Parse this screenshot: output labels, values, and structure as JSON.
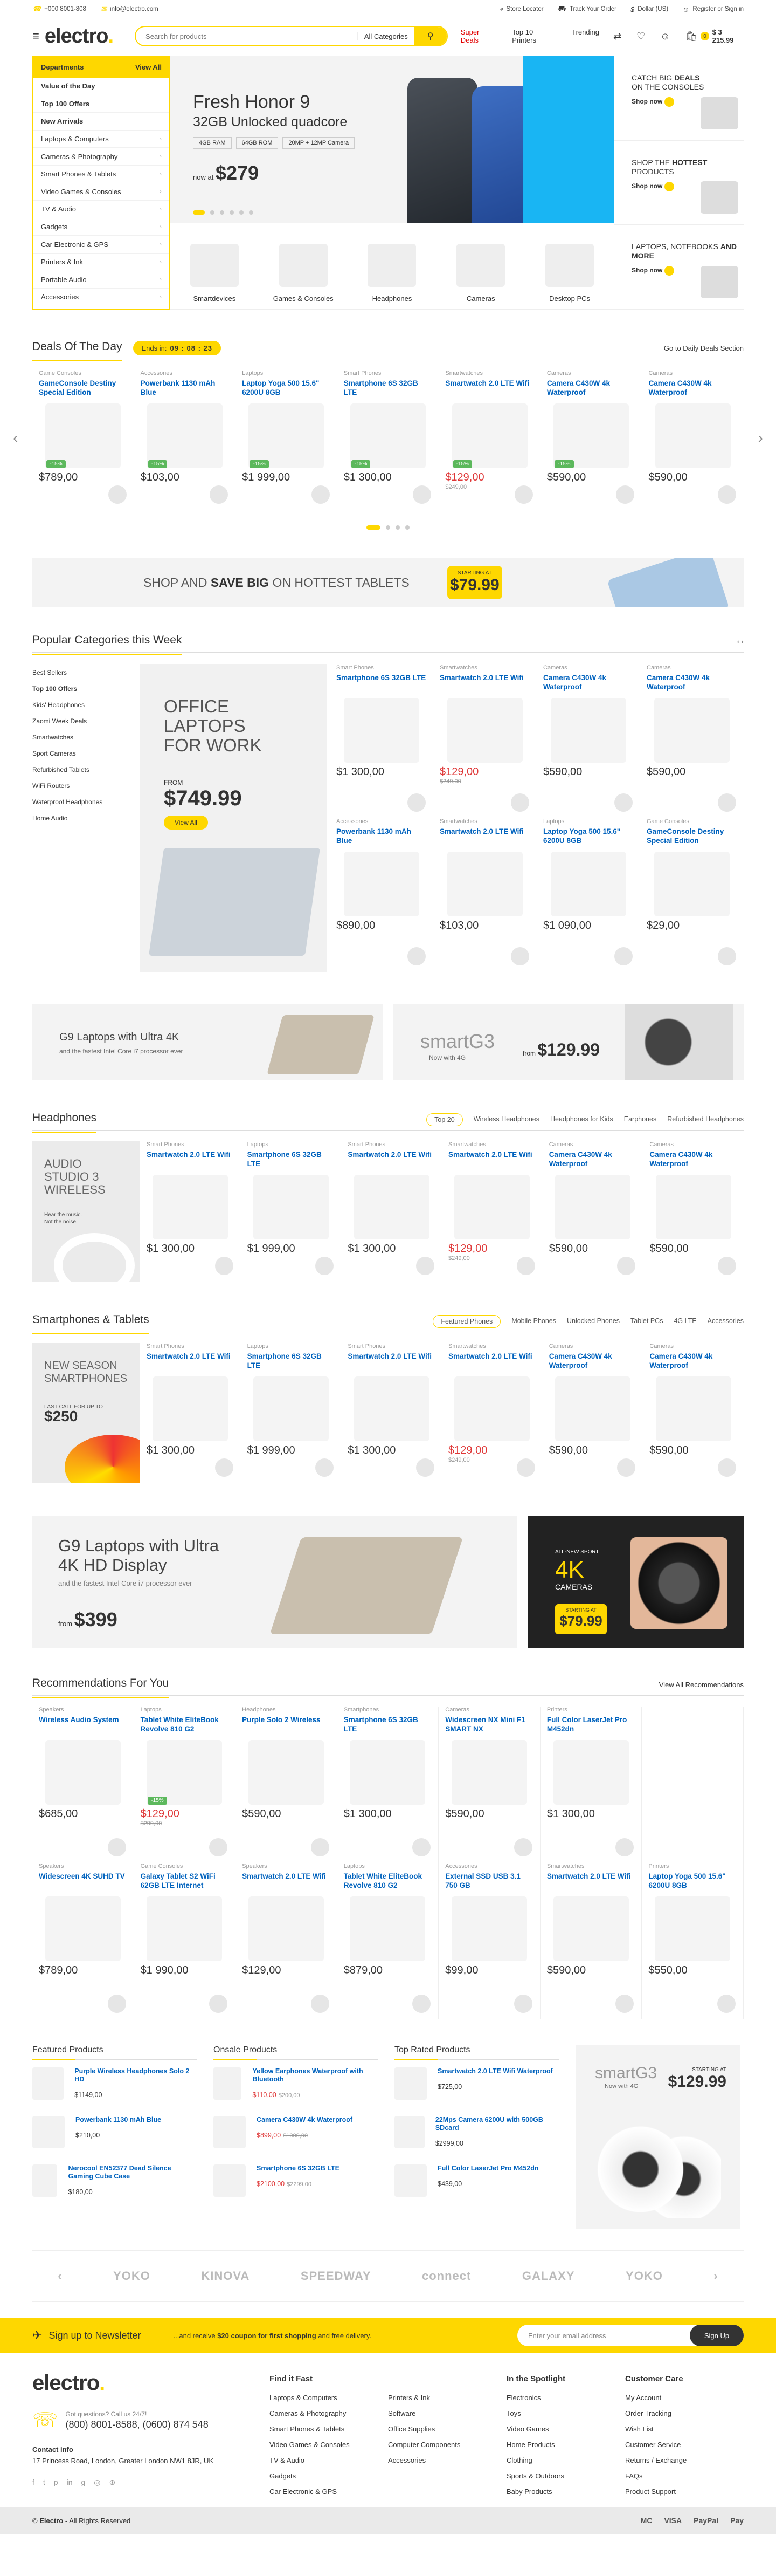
{
  "topbar": {
    "welcome": "+000 8001-808",
    "email": "info@electro.com",
    "store": "Store Locator",
    "track": "Track Your Order",
    "currency": "Dollar (US)",
    "account": "Register or Sign in"
  },
  "header": {
    "logo": "electro",
    "logo_dot": ".",
    "search_placeholder": "Search for products",
    "search_cat": "All Categories",
    "nav": [
      "Super Deals",
      "Top 10 Printers",
      "Trending"
    ],
    "cart_count": "0",
    "cart_total": "$ 3 215.99"
  },
  "dept": {
    "title": "Departments",
    "viewall": "View All",
    "items": [
      "Value of the Day",
      "Top 100 Offers",
      "New Arrivals",
      "Laptops & Computers",
      "Cameras & Photography",
      "Smart Phones & Tablets",
      "Video Games & Consoles",
      "TV & Audio",
      "Gadgets",
      "Car Electronic & GPS",
      "Printers & Ink",
      "Portable Audio",
      "Accessories"
    ]
  },
  "slide": {
    "title": "Fresh Honor 9",
    "sub": "32GB Unlocked quadcore",
    "specs": [
      "4GB RAM",
      "64GB ROM",
      "20MP + 12MP Camera"
    ],
    "nowat": "now at",
    "price": "$279"
  },
  "catrow": [
    "Smartdevices",
    "Games & Consoles",
    "Headphones",
    "Cameras",
    "Desktop PCs"
  ],
  "hboxes": [
    {
      "l1": "CATCH BIG",
      "l2": "DEALS",
      "l3": "ON THE CONSOLES",
      "shop": "Shop now"
    },
    {
      "l1": "SHOP THE",
      "l2": "HOTTEST",
      "l3": "PRODUCTS",
      "shop": "Shop now"
    },
    {
      "l1": "LAPTOPS, NOTEBOOKS",
      "l2": "AND MORE",
      "l3": "",
      "shop": "Shop now"
    }
  ],
  "deals": {
    "title": "Deals Of The Day",
    "timer_label": "Ends in:",
    "timer": "09 : 08 : 23",
    "viewall": "Go to Daily Deals Section",
    "products": [
      {
        "cat": "Game Consoles",
        "name": "GameConsole Destiny Special Edition",
        "sale": "-15%",
        "price": "$789,00",
        "old": ""
      },
      {
        "cat": "Accessories",
        "name": "Powerbank 1130 mAh Blue",
        "sale": "-15%",
        "price": "$103,00",
        "old": ""
      },
      {
        "cat": "Laptops",
        "name": "Laptop Yoga 500 15.6\" 6200U 8GB",
        "sale": "-15%",
        "price": "$1 999,00",
        "old": ""
      },
      {
        "cat": "Smart Phones",
        "name": "Smartphone 6S 32GB LTE",
        "sale": "-15%",
        "price": "$1 300,00",
        "old": ""
      },
      {
        "cat": "Smartwatches",
        "name": "Smartwatch 2.0 LTE Wifi",
        "sale": "-15%",
        "price": "$129,00",
        "old": "$249,00"
      },
      {
        "cat": "Cameras",
        "name": "Camera C430W 4k Waterproof",
        "sale": "-15%",
        "price": "$590,00",
        "old": ""
      },
      {
        "cat": "Cameras",
        "name": "Camera C430W 4k Waterproof",
        "sale": "",
        "price": "$590,00",
        "old": ""
      }
    ]
  },
  "tablet_banner": {
    "t1": "SHOP AND ",
    "t2": "SAVE BIG",
    "t3": " ON HOTTEST TABLETS",
    "st": "STARTING AT",
    "price": "$79.99"
  },
  "popular": {
    "title": "Popular Categories this Week",
    "cats": [
      "Best Sellers",
      "Top 100 Offers",
      "Kids' Headphones",
      "Zaomi Week Deals",
      "Smartwatches",
      "Sport Cameras",
      "Refurbished Tablets",
      "WiFi Routers",
      "Waterproof Headphones",
      "Home Audio"
    ],
    "banner": {
      "title": "OFFICE LAPTOPS FOR WORK",
      "from": "FROM",
      "price": "$749.99",
      "btn": "View All"
    },
    "products": [
      {
        "cat": "Smart Phones",
        "name": "Smartphone 6S 32GB LTE",
        "price": "$1 300,00",
        "old": ""
      },
      {
        "cat": "Smartwatches",
        "name": "Smartwatch 2.0 LTE Wifi",
        "price": "$129,00",
        "old": "$249,00"
      },
      {
        "cat": "Cameras",
        "name": "Camera C430W 4k Waterproof",
        "price": "$590,00",
        "old": ""
      },
      {
        "cat": "Cameras",
        "name": "Camera C430W 4k Waterproof",
        "price": "$590,00",
        "old": ""
      },
      {
        "cat": "Accessories",
        "name": "Powerbank 1130 mAh Blue",
        "price": "$890,00",
        "old": ""
      },
      {
        "cat": "Smartwatches",
        "name": "Smartwatch 2.0 LTE Wifi",
        "price": "$103,00",
        "old": ""
      },
      {
        "cat": "Laptops",
        "name": "Laptop Yoga 500 15.6\" 6200U 8GB",
        "price": "$1 090,00",
        "old": ""
      },
      {
        "cat": "Game Consoles",
        "name": "GameConsole Destiny Special Edition",
        "price": "$29,00",
        "old": ""
      }
    ]
  },
  "twoban": {
    "a1": "G9 Laptops with Ultra 4K",
    "a2": "and the fastest Intel Core i7 processor ever",
    "b1": "smartG3",
    "b2": "Now with 4G",
    "b3": "from",
    "b4": "$129.99"
  },
  "headphones": {
    "title": "Headphones",
    "tabs": [
      "Top 20",
      "Wireless Headphones",
      "Headphones for Kids",
      "Earphones",
      "Refurbished Headphones"
    ],
    "banner": {
      "t": "AUDIO STUDIO 3 WIRELESS",
      "s1": "Hear the music.",
      "s2": "Not the noise."
    },
    "products": [
      {
        "cat": "Smart Phones",
        "name": "Smartwatch 2.0 LTE Wifi",
        "price": "$1 300,00",
        "old": ""
      },
      {
        "cat": "Laptops",
        "name": "Smartphone 6S 32GB LTE",
        "price": "$1 999,00",
        "old": ""
      },
      {
        "cat": "Smart Phones",
        "name": "Smartwatch 2.0 LTE Wifi",
        "price": "$1 300,00",
        "old": ""
      },
      {
        "cat": "Smartwatches",
        "name": "Smartwatch 2.0 LTE Wifi",
        "price": "$129,00",
        "old": "$249,00"
      },
      {
        "cat": "Cameras",
        "name": "Camera C430W 4k Waterproof",
        "price": "$590,00",
        "old": ""
      },
      {
        "cat": "Cameras",
        "name": "Camera C430W 4k Waterproof",
        "price": "$590,00",
        "old": ""
      }
    ]
  },
  "smartphones": {
    "title": "Smartphones & Tablets",
    "tabs": [
      "Featured Phones",
      "Mobile Phones",
      "Unlocked Phones",
      "Tablet PCs",
      "4G LTE",
      "Accessories"
    ],
    "banner": {
      "t": "NEW SEASON SMARTPHONES",
      "s": "LAST CALL FOR UP TO",
      "price": "$250"
    },
    "products": [
      {
        "cat": "Smart Phones",
        "name": "Smartwatch 2.0 LTE Wifi",
        "price": "$1 300,00",
        "old": ""
      },
      {
        "cat": "Laptops",
        "name": "Smartphone 6S 32GB LTE",
        "price": "$1 999,00",
        "old": ""
      },
      {
        "cat": "Smart Phones",
        "name": "Smartwatch 2.0 LTE Wifi",
        "price": "$1 300,00",
        "old": ""
      },
      {
        "cat": "Smartwatches",
        "name": "Smartwatch 2.0 LTE Wifi",
        "price": "$129,00",
        "old": "$249,00"
      },
      {
        "cat": "Cameras",
        "name": "Camera C430W 4k Waterproof",
        "price": "$590,00",
        "old": ""
      },
      {
        "cat": "Cameras",
        "name": "Camera C430W 4k Waterproof",
        "price": "$590,00",
        "old": ""
      }
    ]
  },
  "big2": {
    "t": "G9 Laptops with Ultra 4K HD Display",
    "s": "and the fastest Intel Core i7 processor ever",
    "from": "from",
    "price": "$399",
    "r1": "ALL-NEW SPORT",
    "r2": "4K",
    "r3": "CAMERAS",
    "r4": "STARTING AT",
    "r5": "$79.99"
  },
  "rec": {
    "title": "Recommendations For You",
    "viewall": "View All Recommendations",
    "products": [
      {
        "cat": "Speakers",
        "name": "Wireless Audio System",
        "price": "$685,00",
        "old": ""
      },
      {
        "cat": "Laptops",
        "name": "Tablet White EliteBook Revolve 810 G2",
        "price": "$129,00",
        "old": "$299,00",
        "sale": "-15%"
      },
      {
        "cat": "Headphones",
        "name": "Purple Solo 2 Wireless",
        "price": "$590,00",
        "old": ""
      },
      {
        "cat": "Smartphones",
        "name": "Smartphone 6S 32GB LTE",
        "price": "$1 300,00",
        "old": ""
      },
      {
        "cat": "Cameras",
        "name": "Widescreen NX Mini F1 SMART NX",
        "price": "$590,00",
        "old": ""
      },
      {
        "cat": "Printers",
        "name": "Full Color LaserJet Pro M452dn",
        "price": "$1 300,00",
        "old": ""
      },
      {
        "cat": "",
        "name": "",
        "price": "",
        "old": ""
      },
      {
        "cat": "Speakers",
        "name": "Widescreen 4K SUHD TV",
        "price": "$789,00",
        "old": ""
      },
      {
        "cat": "Game Consoles",
        "name": "Galaxy Tablet S2 WiFi 62GB LTE Internet",
        "price": "$1 990,00",
        "old": ""
      },
      {
        "cat": "Speakers",
        "name": "Smartwatch 2.0 LTE Wifi",
        "price": "$129,00",
        "old": ""
      },
      {
        "cat": "Laptops",
        "name": "Tablet White EliteBook Revolve 810 G2",
        "price": "$879,00",
        "old": ""
      },
      {
        "cat": "Accessories",
        "name": "External SSD USB 3.1 750 GB",
        "price": "$99,00",
        "old": ""
      },
      {
        "cat": "Smartwatches",
        "name": "Smartwatch 2.0 LTE Wifi",
        "price": "$590,00",
        "old": ""
      },
      {
        "cat": "Printers",
        "name": "Laptop Yoga 500 15.6\" 6200U 8GB",
        "price": "$550,00",
        "old": ""
      }
    ]
  },
  "lists": [
    {
      "title": "Featured Products",
      "items": [
        {
          "n": "Purple Wireless Headphones Solo 2 HD",
          "p": "$1149,00",
          "o": ""
        },
        {
          "n": "Powerbank 1130 mAh Blue",
          "p": "$210,00",
          "o": ""
        },
        {
          "n": "Nerocool EN52377 Dead Silence Gaming Cube Case",
          "p": "$180,00",
          "o": ""
        }
      ]
    },
    {
      "title": "Onsale Products",
      "items": [
        {
          "n": "Yellow Earphones Waterproof with Bluetooth",
          "p": "$110,00",
          "o": "$200,00"
        },
        {
          "n": "Camera C430W 4k Waterproof",
          "p": "$899,00",
          "o": "$1000,00"
        },
        {
          "n": "Smartphone 6S 32GB LTE",
          "p": "$2100,00",
          "o": "$2299,00"
        }
      ]
    },
    {
      "title": "Top Rated Products",
      "items": [
        {
          "n": "Smartwatch 2.0 LTE Wifi Waterproof",
          "p": "$725,00",
          "o": ""
        },
        {
          "n": "22Mps Camera 6200U with 500GB SDcard",
          "p": "$2999,00",
          "o": ""
        },
        {
          "n": "Full Color LaserJet Pro M452dn",
          "p": "$439,00",
          "o": ""
        }
      ]
    }
  ],
  "smart": {
    "a": "smartG3",
    "b": "Now with 4G",
    "c": "STARTING AT",
    "price": "$129.99"
  },
  "brands": [
    "YOKO",
    "KINOVA",
    "SPEEDWAY",
    "connect",
    "GALAXY",
    "YOKO"
  ],
  "news": {
    "h": "Sign up to Newsletter",
    "p1": "...and receive ",
    "p2": "$20 coupon for first shopping",
    "p3": " and free delivery.",
    "placeholder": "Enter your email address",
    "btn": "Sign Up"
  },
  "footer": {
    "logo": "electro",
    "q1": "Got questions? Call us 24/7!",
    "q2": "(800) 8001-8588, (0600) 874 548",
    "ci": "Contact info",
    "addr": "17 Princess Road, London, Greater London NW1 8JR, UK",
    "cols": [
      {
        "h": "Find it Fast",
        "items": [
          "Laptops & Computers",
          "Cameras & Photography",
          "Smart Phones & Tablets",
          "Video Games & Consoles",
          "TV & Audio",
          "Gadgets",
          "Car Electronic & GPS"
        ]
      },
      {
        "h": "",
        "items": [
          "Printers & Ink",
          "Software",
          "Office Supplies",
          "Computer Components",
          "Accessories"
        ]
      },
      {
        "h": "In the Spotlight",
        "items": [
          "Electronics",
          "Toys",
          "Video Games",
          "Home Products",
          "Clothing",
          "Sports & Outdoors",
          "Baby Products"
        ]
      },
      {
        "h": "Customer Care",
        "items": [
          "My Account",
          "Order Tracking",
          "Wish List",
          "Customer Service",
          "Returns / Exchange",
          "FAQs",
          "Product Support"
        ]
      }
    ],
    "copy1": "© ",
    "copy2": "Electro",
    "copy3": " - All Rights Reserved",
    "pays": [
      "MC",
      "VISA",
      "PayPal",
      "Pay"
    ]
  },
  "colors": {
    "accent": "#fed700",
    "link": "#0062bd",
    "sale_price": "#df3737"
  }
}
